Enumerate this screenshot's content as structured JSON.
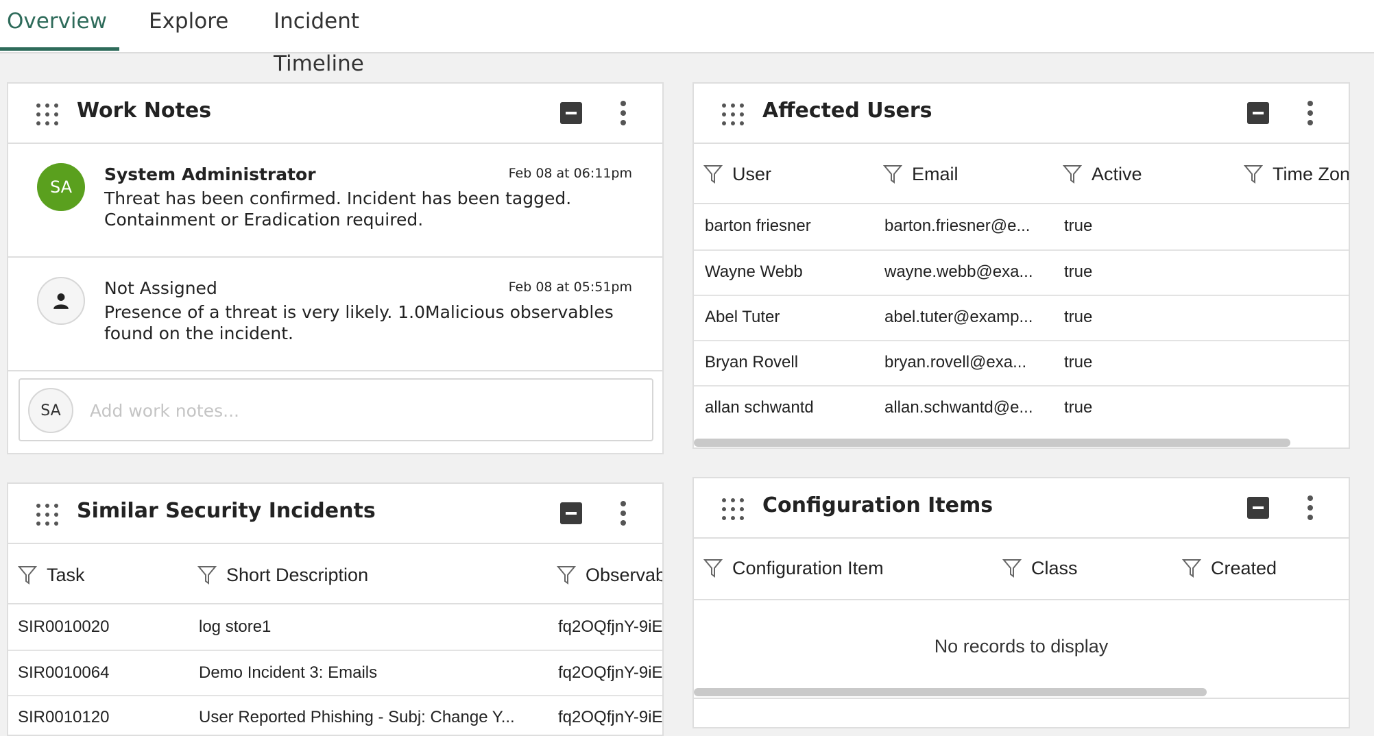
{
  "tabs": [
    {
      "label": "Overview",
      "active": true
    },
    {
      "label": "Explore",
      "active": false
    },
    {
      "label": "Incident Timeline",
      "active": false
    }
  ],
  "accent_color": "#2e6b5a",
  "work_notes": {
    "title": "Work Notes",
    "notes": [
      {
        "avatar": "SA",
        "author": "System Administrator",
        "time": "Feb 08 at 06:11pm",
        "text": "Threat has been confirmed. Incident has been tagged. Containment or Eradication required."
      },
      {
        "avatar_icon": "person-icon",
        "author": "Not Assigned",
        "time": "Feb 08 at 05:51pm",
        "text": "Presence of a threat is very likely. 1.0Malicious observables found on the incident."
      }
    ],
    "compose": {
      "avatar": "SA",
      "placeholder": "Add work notes..."
    }
  },
  "affected_users": {
    "title": "Affected Users",
    "columns": [
      "User",
      "Email",
      "Active",
      "Time Zon"
    ],
    "rows": [
      {
        "user": "barton friesner",
        "email": "barton.friesner@e...",
        "active": "true"
      },
      {
        "user": "Wayne Webb",
        "email": "wayne.webb@exa...",
        "active": "true"
      },
      {
        "user": "Abel Tuter",
        "email": "abel.tuter@examp...",
        "active": "true"
      },
      {
        "user": "Bryan Rovell",
        "email": "bryan.rovell@exa...",
        "active": "true"
      },
      {
        "user": "allan schwantd",
        "email": "allan.schwantd@e...",
        "active": "true"
      }
    ]
  },
  "similar_incidents": {
    "title": "Similar Security Incidents",
    "columns": [
      "Task",
      "Short Description",
      "Observab"
    ],
    "rows": [
      {
        "task": "SIR0010020",
        "desc": "log store1",
        "obs": "fq2OQfjnY-9iE"
      },
      {
        "task": "SIR0010064",
        "desc": "Demo Incident 3: Emails",
        "obs": "fq2OQfjnY-9iE"
      },
      {
        "task": "SIR0010120",
        "desc": "User Reported Phishing - Subj: Change Y...",
        "obs": "fq2OQfjnY-9iE"
      }
    ]
  },
  "config_items": {
    "title": "Configuration Items",
    "columns": [
      "Configuration Item",
      "Class",
      "Created"
    ],
    "empty_message": "No records to display"
  }
}
